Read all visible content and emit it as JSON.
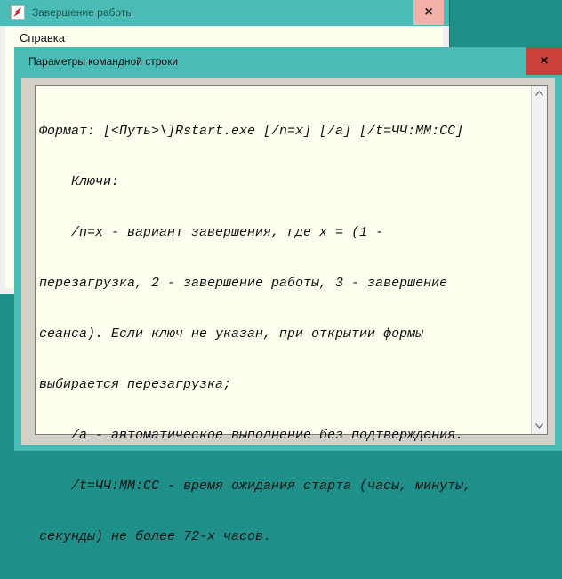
{
  "background_window": {
    "title": "Завершение работы",
    "close_glyph": "×",
    "menu": [
      "Справка"
    ]
  },
  "dialog": {
    "title": "Параметры командной строки",
    "close_glyph": "×",
    "text_lines": [
      "Формат: [<Путь>\\]Rstart.exe [/n=x] [/a] [/t=ЧЧ:ММ:СС]",
      "    Ключи:",
      "    /n=x - вариант завершения, где x = (1 -",
      "перезагрузка, 2 - завершение работы, 3 - завершение",
      "сеанса). Если ключ не указан, при открытии формы",
      "выбирается перезагрузка;",
      "    /a - автоматическое выполнение без подтверждения.",
      "    /t=ЧЧ:ММ:СС - время ожидания старта (часы, минуты,",
      "секунды) не более 72-х часов."
    ]
  },
  "icons": {
    "app_icon": "power-off-icon",
    "scroll_up": "arrow-up-icon",
    "scroll_down": "arrow-down-icon"
  },
  "colors": {
    "title_bar": "#4bbcb5",
    "desktop": "#1f8f89",
    "close_active": "#c9403a",
    "close_inactive": "#f3b1a9",
    "memo_bg": "#fffff0",
    "client_bg": "#d4d0c8"
  }
}
